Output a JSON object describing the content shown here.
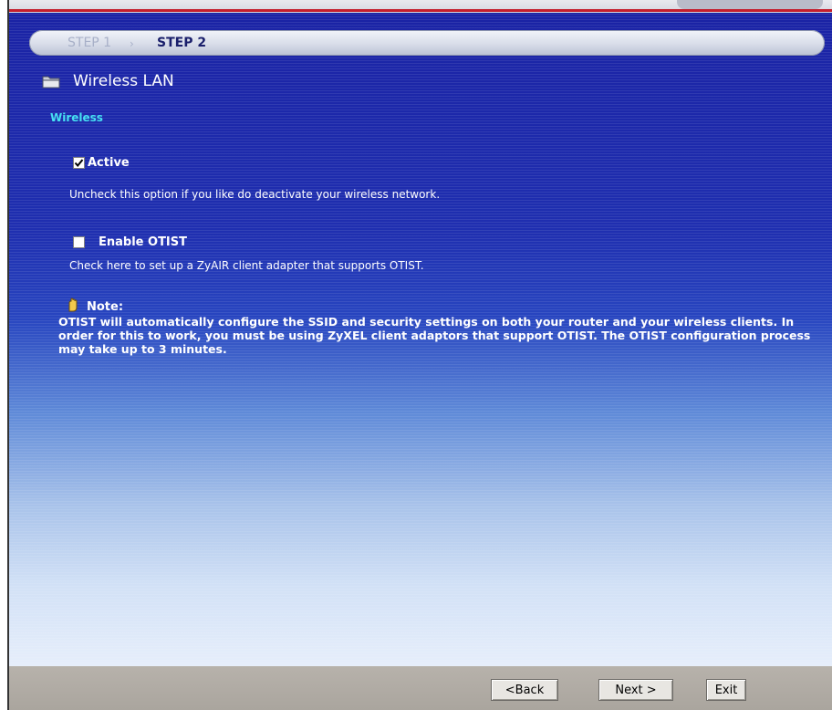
{
  "steps": {
    "step1": "STEP 1",
    "separator": "›",
    "step2": "STEP 2"
  },
  "header": {
    "title": "Wireless LAN",
    "icon": "folder-icon"
  },
  "section": {
    "title": "Wireless"
  },
  "active_option": {
    "label": "Active",
    "checked": true,
    "description": "Uncheck this option if you like do deactivate your wireless network."
  },
  "otist_option": {
    "label": "Enable OTIST",
    "checked": false,
    "description": "Check here to set up a ZyAIR client adapter that supports OTIST."
  },
  "note": {
    "label": "Note:",
    "icon": "hand-icon",
    "text": "OTIST will automatically configure the SSID and security settings on both your router and your wireless clients. In order for this to work, you must be using ZyXEL client adaptors that support OTIST. The OTIST configuration process may take up to 3 minutes."
  },
  "buttons": {
    "back": "<Back",
    "next": "Next >",
    "exit": "Exit"
  },
  "colors": {
    "background_top": "#1a22a4",
    "background_bottom": "#e6eefb",
    "section_title": "#46e0f2",
    "accent_red": "#c41e2d",
    "bottom_bar": "#b7b2ab"
  }
}
